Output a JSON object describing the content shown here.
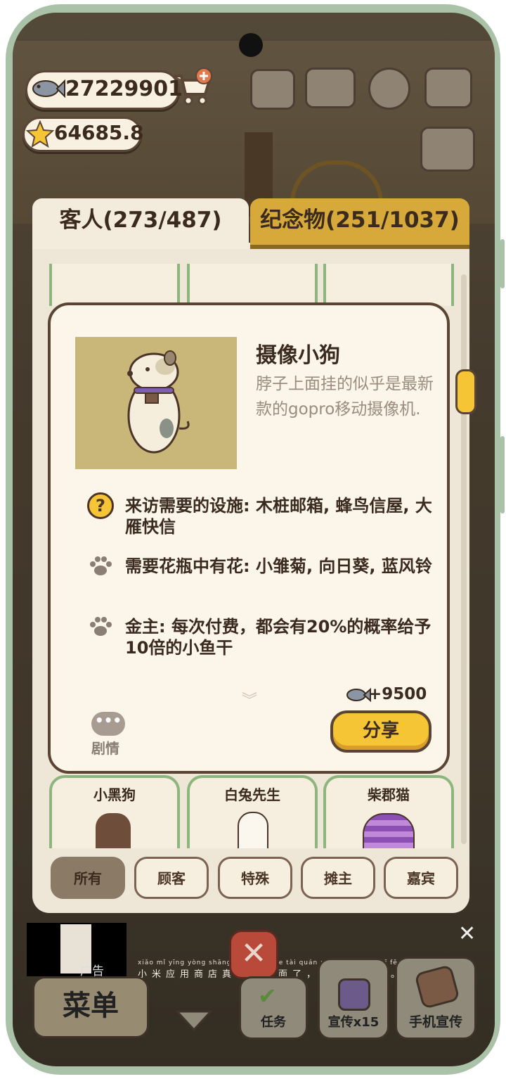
{
  "header": {
    "fish_count": "27229901",
    "star_count": "64685.8"
  },
  "tabs": [
    {
      "label": "客人(273/487)"
    },
    {
      "label": "纪念物(251/1037)"
    }
  ],
  "detail": {
    "name": "摄像小狗",
    "description": "脖子上面挂的似乎是最新款的gopro移动摄像机.",
    "requirements": [
      {
        "icon": "question-icon",
        "text": "来访需要的设施: 木桩邮箱, 蜂鸟信屋, 大雁快信"
      },
      {
        "icon": "paw-icon",
        "text": "需要花瓶中有花: 小雏菊, 向日葵, 蓝风铃"
      },
      {
        "icon": "paw-icon",
        "text": "金主: 每次付费，都会有20%的概率给予10倍的小鱼干"
      }
    ],
    "reward": "+9500",
    "story_label": "剧情",
    "share_label": "分享"
  },
  "cards_bottom": [
    "小黑狗",
    "白兔先生",
    "柴郡猫"
  ],
  "filters": [
    "所有",
    "顾客",
    "特殊",
    "摊主",
    "嘉宾"
  ],
  "ad": {
    "label": "广告",
    "pinyin": "xiǎo mǐ yīng yòng shāng diàn zhēn de tài quán miàn le  bù huā yī fēn qián",
    "caption": "小米应用商店真的太全面了，不花一分钱。"
  },
  "bottom_bar": {
    "menu": "菜单",
    "task": "任务",
    "promo": "宣传x15",
    "phone_promo": "手机宣传"
  },
  "colors": {
    "accent_yellow": "#f6c536",
    "brown": "#5a4434",
    "green_border": "#8fb57e"
  }
}
